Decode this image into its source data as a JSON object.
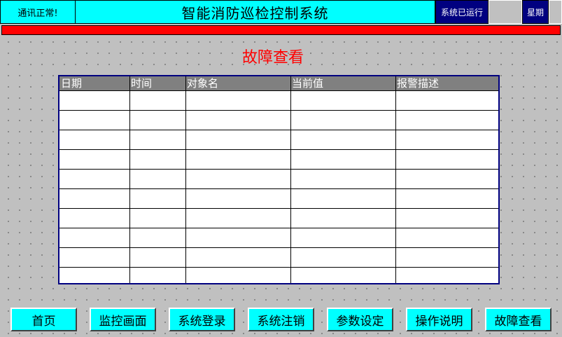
{
  "header": {
    "comm_status": "通讯正常!",
    "title": "智能消防巡检控制系统",
    "run_label": "系统已运行",
    "run_value": "",
    "week_label": "星期",
    "week_value": ""
  },
  "page": {
    "title": "故障查看"
  },
  "table": {
    "columns": [
      "日期",
      "时间",
      "对象名",
      "当前值",
      "报警描述"
    ],
    "rows": [
      [
        "",
        "",
        "",
        "",
        ""
      ],
      [
        "",
        "",
        "",
        "",
        ""
      ],
      [
        "",
        "",
        "",
        "",
        ""
      ],
      [
        "",
        "",
        "",
        "",
        ""
      ],
      [
        "",
        "",
        "",
        "",
        ""
      ],
      [
        "",
        "",
        "",
        "",
        ""
      ],
      [
        "",
        "",
        "",
        "",
        ""
      ],
      [
        "",
        "",
        "",
        "",
        ""
      ],
      [
        "",
        "",
        "",
        "",
        ""
      ],
      [
        "",
        "",
        "",
        "",
        ""
      ]
    ]
  },
  "nav": {
    "buttons": [
      "首页",
      "监控画面",
      "系统登录",
      "系统注销",
      "参数设定",
      "操作说明",
      "故障查看"
    ]
  },
  "colors": {
    "header_bg": "#00ffff",
    "status_bg": "#000080",
    "alarm_bar": "#ff0000",
    "title_text": "#ff0000",
    "table_header": "#808080",
    "button_bg": "#00ffff"
  }
}
